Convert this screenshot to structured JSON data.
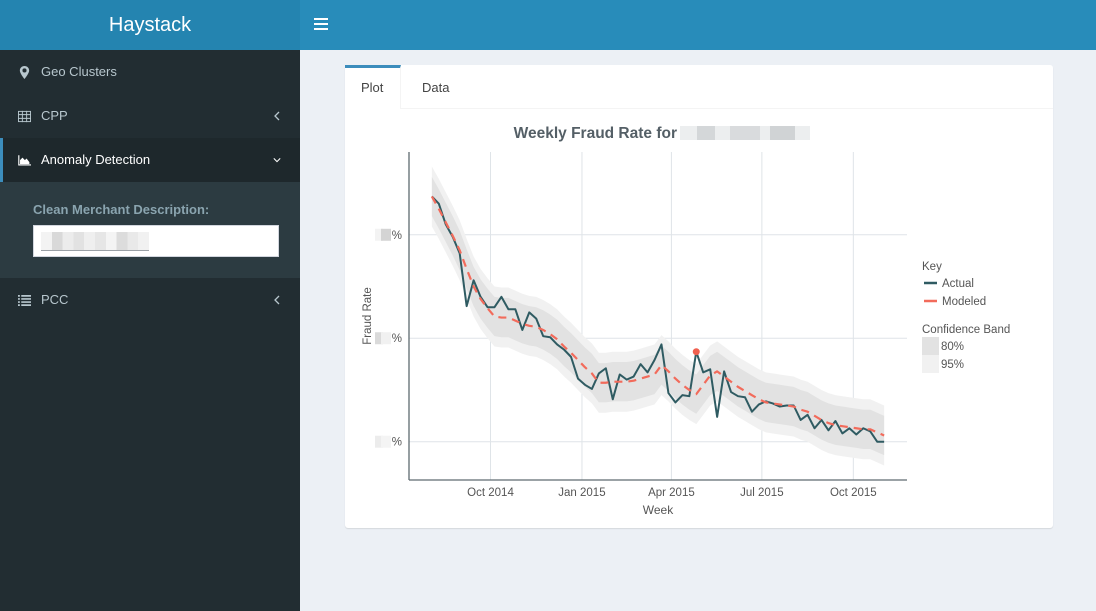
{
  "app": {
    "title": "Haystack"
  },
  "header": {
    "menu_toggle_icon": "hamburger-icon"
  },
  "sidebar": {
    "items": [
      {
        "label": "Geo Clusters",
        "icon": "map-marker-icon"
      },
      {
        "label": "CPP",
        "icon": "table-icon",
        "chevron": "chevron-left-icon"
      },
      {
        "label": "Anomaly Detection",
        "icon": "area-chart-icon",
        "chevron": "chevron-down-icon",
        "active": true
      },
      {
        "label": "PCC",
        "icon": "list-icon",
        "chevron": "chevron-left-icon"
      }
    ],
    "submenu": {
      "field_label": "Clean Merchant Description:",
      "field_value_redacted": true
    }
  },
  "tabs": [
    {
      "label": "Plot",
      "active": true
    },
    {
      "label": "Data",
      "active": false
    }
  ],
  "colors": {
    "header": "#288cba",
    "logo": "#2484b0",
    "accent": "#3c8dbc",
    "sidebar": "#222d32",
    "actual": "#2f5b62",
    "modeled": "#f26b5b",
    "band_80": "#e2e2e2",
    "band_95": "#f1f1f1",
    "anomaly": "#f0604f"
  },
  "chart_data": {
    "type": "line",
    "title": "Weekly Fraud Rate for",
    "title_suffix_redacted": true,
    "xlabel": "Week",
    "ylabel": "Fraud Rate",
    "grid": true,
    "xlim": [
      "2014-07-11",
      "2015-11-24"
    ],
    "ylim": [
      -0.37,
      2.8
    ],
    "x_ticks": [
      {
        "date": "2014-10-01",
        "label": "Oct 2014"
      },
      {
        "date": "2015-01-01",
        "label": "Jan 2015"
      },
      {
        "date": "2015-04-01",
        "label": "Apr 2015"
      },
      {
        "date": "2015-07-01",
        "label": "Jul 2015"
      },
      {
        "date": "2015-10-01",
        "label": "Oct 2015"
      }
    ],
    "y_ticks": [
      {
        "value": 0,
        "label": "%",
        "value_redacted": true
      },
      {
        "value": 1,
        "label": "%",
        "value_redacted": true
      },
      {
        "value": 2,
        "label": "%",
        "value_redacted": true
      }
    ],
    "x": [
      "2014-08-03",
      "2014-08-10",
      "2014-08-17",
      "2014-08-24",
      "2014-08-31",
      "2014-09-07",
      "2014-09-14",
      "2014-09-21",
      "2014-09-28",
      "2014-10-05",
      "2014-10-12",
      "2014-10-19",
      "2014-10-26",
      "2014-11-02",
      "2014-11-09",
      "2014-11-16",
      "2014-11-23",
      "2014-11-30",
      "2014-12-07",
      "2014-12-14",
      "2014-12-21",
      "2014-12-28",
      "2015-01-04",
      "2015-01-11",
      "2015-01-18",
      "2015-01-25",
      "2015-02-01",
      "2015-02-08",
      "2015-02-15",
      "2015-02-22",
      "2015-03-01",
      "2015-03-08",
      "2015-03-15",
      "2015-03-22",
      "2015-03-29",
      "2015-04-05",
      "2015-04-12",
      "2015-04-19",
      "2015-04-26",
      "2015-05-03",
      "2015-05-10",
      "2015-05-17",
      "2015-05-24",
      "2015-05-31",
      "2015-06-07",
      "2015-06-14",
      "2015-06-21",
      "2015-06-28",
      "2015-07-05",
      "2015-07-12",
      "2015-07-19",
      "2015-07-26",
      "2015-08-02",
      "2015-08-09",
      "2015-08-16",
      "2015-08-23",
      "2015-08-30",
      "2015-09-06",
      "2015-09-13",
      "2015-09-20",
      "2015-09-27",
      "2015-10-04",
      "2015-10-11",
      "2015-10-18",
      "2015-10-25",
      "2015-11-01"
    ],
    "series": [
      {
        "name": "Actual",
        "style": "solid",
        "values": [
          2.37,
          2.3,
          2.1,
          1.98,
          1.82,
          1.31,
          1.56,
          1.4,
          1.3,
          1.3,
          1.4,
          1.28,
          1.28,
          1.08,
          1.25,
          1.19,
          1.02,
          1.01,
          0.94,
          0.89,
          0.82,
          0.61,
          0.55,
          0.51,
          0.66,
          0.71,
          0.41,
          0.65,
          0.6,
          0.63,
          0.75,
          0.67,
          0.79,
          0.94,
          0.47,
          0.38,
          0.45,
          0.44,
          0.87,
          0.67,
          0.7,
          0.24,
          0.68,
          0.48,
          0.44,
          0.43,
          0.29,
          0.36,
          0.39,
          0.37,
          0.34,
          0.35,
          0.35,
          0.21,
          0.26,
          0.13,
          0.21,
          0.11,
          0.2,
          0.08,
          0.13,
          0.07,
          0.13,
          0.1,
          0.0,
          0.0
        ]
      },
      {
        "name": "Modeled",
        "style": "dashed",
        "values": [
          2.37,
          2.25,
          2.12,
          1.99,
          1.85,
          1.67,
          1.5,
          1.38,
          1.29,
          1.21,
          1.2,
          1.2,
          1.17,
          1.14,
          1.12,
          1.11,
          1.08,
          1.04,
          0.99,
          0.92,
          0.86,
          0.79,
          0.72,
          0.66,
          0.57,
          0.57,
          0.58,
          0.58,
          0.58,
          0.59,
          0.61,
          0.63,
          0.65,
          0.74,
          0.68,
          0.61,
          0.55,
          0.5,
          0.46,
          0.55,
          0.64,
          0.68,
          0.63,
          0.58,
          0.53,
          0.49,
          0.45,
          0.41,
          0.38,
          0.37,
          0.36,
          0.35,
          0.34,
          0.31,
          0.29,
          0.25,
          0.21,
          0.18,
          0.16,
          0.15,
          0.14,
          0.13,
          0.12,
          0.12,
          0.09,
          0.06
        ]
      }
    ],
    "bands": [
      {
        "name": "95%",
        "around": "Modeled",
        "halfwidth": 0.29
      },
      {
        "name": "80%",
        "around": "Modeled",
        "halfwidth": 0.19
      }
    ],
    "anomalies": [
      {
        "index": 38,
        "date": "2015-04-26",
        "value": 0.87
      }
    ],
    "legend": {
      "position": "right",
      "title": "Key",
      "items": [
        "Actual",
        "Modeled"
      ],
      "band_title": "Confidence Band",
      "band_items": [
        "80%",
        "95%"
      ]
    }
  }
}
